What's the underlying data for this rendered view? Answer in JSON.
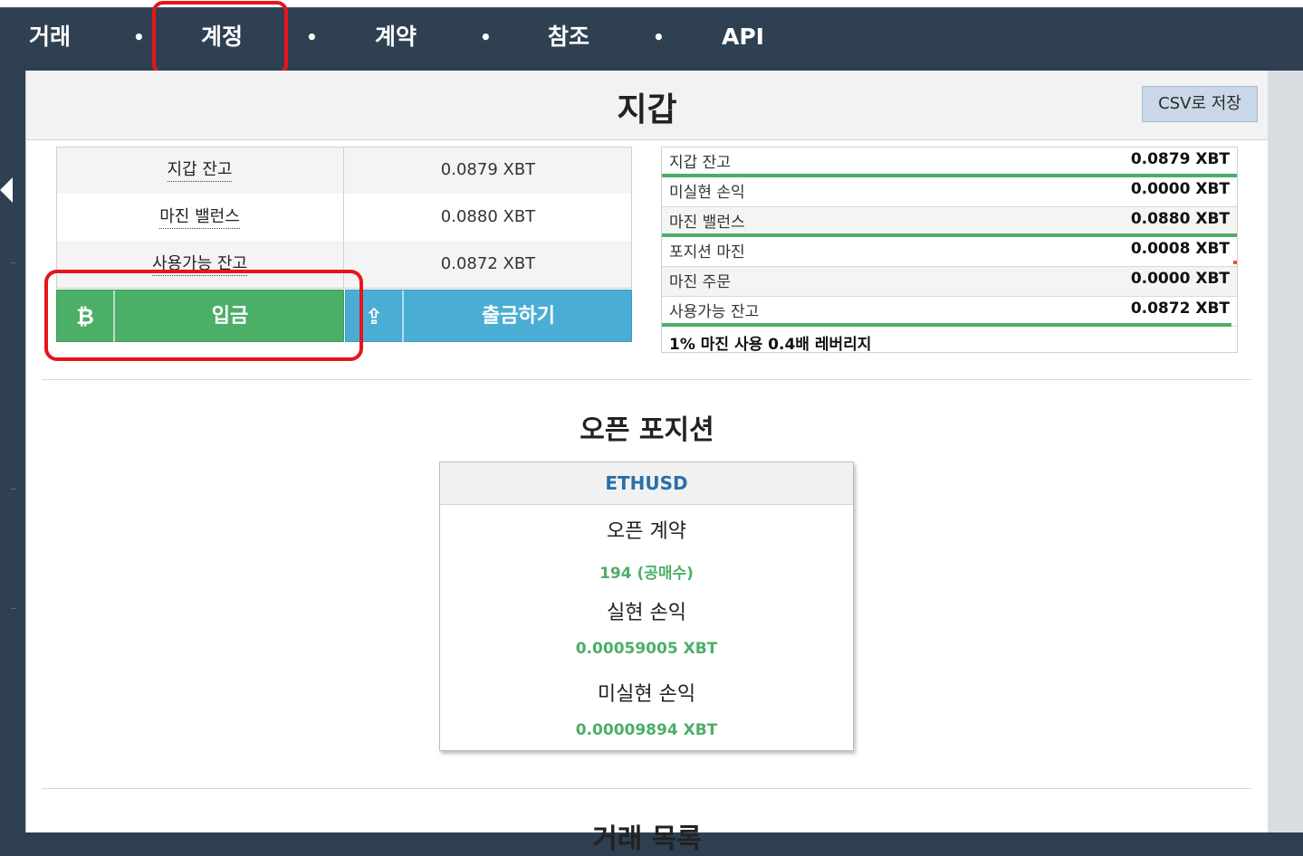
{
  "nav": {
    "items": [
      "거래",
      "계정",
      "계약",
      "참조",
      "API"
    ],
    "separator": "•",
    "active_index": 1
  },
  "page": {
    "title": "지갑",
    "csv_button": "CSV로 저장"
  },
  "wallet_table": [
    {
      "label": "지갑 잔고",
      "value": "0.0879 XBT"
    },
    {
      "label": "마진 밸런스",
      "value": "0.0880 XBT"
    },
    {
      "label": "사용가능 잔고",
      "value": "0.0872 XBT"
    }
  ],
  "buttons": {
    "deposit_icon": "₿",
    "deposit": "입금",
    "withdraw_icon": "⇪",
    "withdraw": "출금하기"
  },
  "summary": {
    "rows": [
      {
        "label": "지갑 잔고",
        "value": "0.0879 XBT",
        "bar_fraction": 1.0
      },
      {
        "label": "미실현 손익",
        "value": "0.0000 XBT",
        "bar_fraction": 0
      },
      {
        "label": "마진 밸런스",
        "value": "0.0880 XBT",
        "bar_fraction": 1.0
      },
      {
        "label": "포지션 마진",
        "value": "0.0008 XBT",
        "bar_fraction": 0
      },
      {
        "label": "마진 주문",
        "value": "0.0000 XBT",
        "bar_fraction": 0
      },
      {
        "label": "사용가능 잔고",
        "value": "0.0872 XBT",
        "bar_fraction": 0.99
      }
    ],
    "footer": "1% 마진 사용 0.4배 레버리지"
  },
  "open_positions": {
    "title": "오픈 포지션",
    "symbol": "ETHUSD",
    "open_contracts_label": "오픈 계약",
    "open_contracts_value": "194 (공매수)",
    "realized_pnl_label": "실현 손익",
    "realized_pnl_value": "0.00059005 XBT",
    "unrealized_pnl_label": "미실현 손익",
    "unrealized_pnl_value": "0.00009894 XBT"
  },
  "next_section_title": "거래 목록",
  "colors": {
    "nav_bg": "#2f4052",
    "deposit": "#4caf68",
    "withdraw": "#4aaed4",
    "highlight": "#e8141c",
    "symbol": "#2a6fa8"
  }
}
